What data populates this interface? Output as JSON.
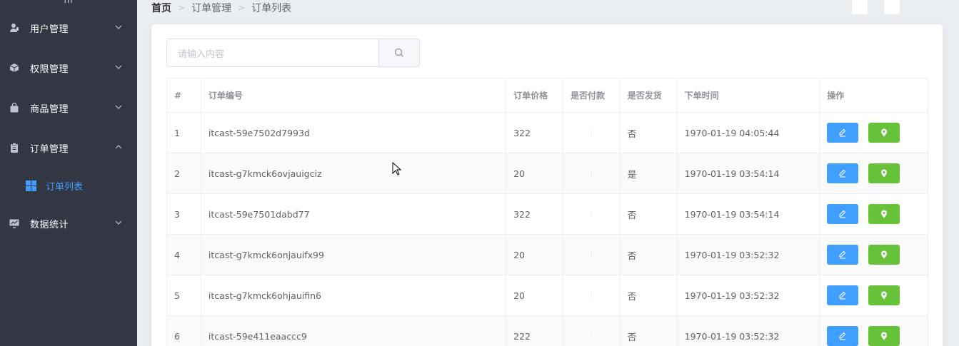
{
  "sidebar": {
    "toggle_label": "|||",
    "menus": [
      {
        "label": "用户管理",
        "icon": "user-icon",
        "expanded": false
      },
      {
        "label": "权限管理",
        "icon": "box-icon",
        "expanded": false
      },
      {
        "label": "商品管理",
        "icon": "bag-icon",
        "expanded": false
      },
      {
        "label": "订单管理",
        "icon": "clipboard-icon",
        "expanded": true
      },
      {
        "label": "数据统计",
        "icon": "chart-icon",
        "expanded": false
      }
    ],
    "active_sub": {
      "label": "订单列表",
      "icon": "grid-icon"
    }
  },
  "breadcrumb": {
    "items": [
      "首页",
      "订单管理",
      "订单列表"
    ],
    "separator": ">"
  },
  "search": {
    "placeholder": "请输入内容",
    "button_icon": "search-icon"
  },
  "table": {
    "headers": [
      "#",
      "订单编号",
      "订单价格",
      "是否付款",
      "是否发货",
      "下单时间",
      "操作"
    ],
    "rows": [
      {
        "index": "1",
        "order_no": "itcast-59e7502d7993d",
        "price": "322",
        "paid": "",
        "shipped": "否",
        "time": "1970-01-19 04:05:44"
      },
      {
        "index": "2",
        "order_no": "itcast-g7kmck6ovjauigciz",
        "price": "20",
        "paid": "",
        "shipped": "是",
        "time": "1970-01-19 03:54:14"
      },
      {
        "index": "3",
        "order_no": "itcast-59e7501dabd77",
        "price": "322",
        "paid": "",
        "shipped": "否",
        "time": "1970-01-19 03:54:14"
      },
      {
        "index": "4",
        "order_no": "itcast-g7kmck6onjauifx99",
        "price": "20",
        "paid": "",
        "shipped": "否",
        "time": "1970-01-19 03:52:32"
      },
      {
        "index": "5",
        "order_no": "itcast-g7kmck6ohjauifin6",
        "price": "20",
        "paid": "",
        "shipped": "否",
        "time": "1970-01-19 03:52:32"
      },
      {
        "index": "6",
        "order_no": "itcast-59e411eaaccc9",
        "price": "222",
        "paid": "",
        "shipped": "否",
        "time": "1970-01-19 03:52:32"
      }
    ],
    "actions": {
      "edit_icon": "edit-icon",
      "location_icon": "location-icon"
    }
  },
  "colors": {
    "sidebar_bg": "#333744",
    "accent": "#409eff",
    "success": "#67c23a",
    "page_bg": "#eaedf1"
  }
}
